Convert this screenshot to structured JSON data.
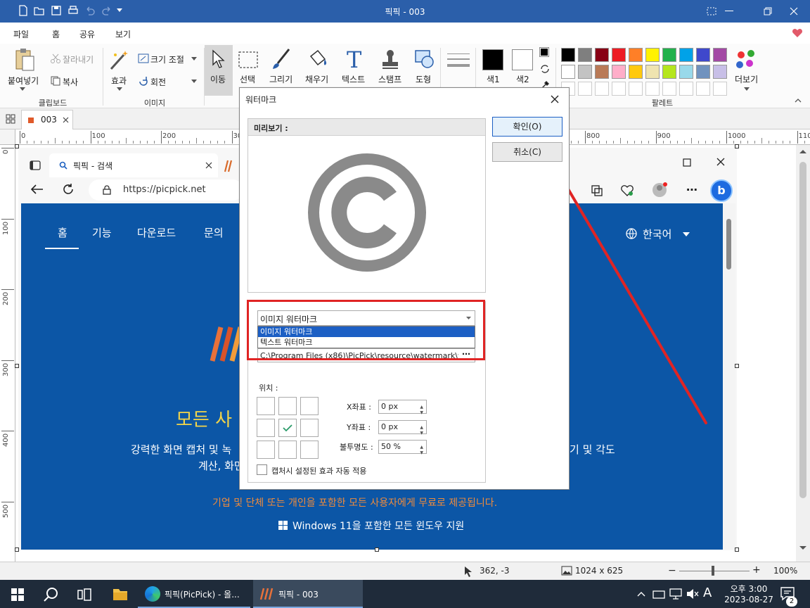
{
  "app": {
    "title": "픽픽 - 003"
  },
  "menu": [
    "파일",
    "홈",
    "공유",
    "보기"
  ],
  "ribbon": {
    "paste": "붙여넣기",
    "cut": "잘라내기",
    "copy": "복사",
    "clipboard_group": "클립보드",
    "effects": "효과",
    "resize": "크기 조절",
    "rotate": "회전",
    "image_group": "이미지",
    "tools": [
      "이동",
      "선택",
      "그리기",
      "채우기",
      "텍스트",
      "스탬프",
      "도형"
    ],
    "color1": "색1",
    "color2": "색2",
    "more": "더보기",
    "palette_group": "팔레트"
  },
  "palette": {
    "row1": [
      "#000000",
      "#7f7f7f",
      "#880015",
      "#ed1c24",
      "#ff7f27",
      "#fff200",
      "#22b14c",
      "#00a2e8",
      "#3f48cc",
      "#a349a4"
    ],
    "row2": [
      "#ffffff",
      "#c3c3c3",
      "#b97a57",
      "#ffaec9",
      "#ffc90e",
      "#efe4b0",
      "#b5e61d",
      "#99d9ea",
      "#7092be",
      "#c8bfe7"
    ]
  },
  "tab": {
    "name": "003"
  },
  "ruler": {
    "top": [
      "0",
      "100",
      "200",
      "300",
      "400",
      "500",
      "600",
      "700",
      "800",
      "900",
      "1000",
      "1100"
    ],
    "left": [
      "0",
      "100",
      "200",
      "300",
      "400",
      "500"
    ]
  },
  "browser": {
    "tab_title": "픽픽 - 검색",
    "url": "https://picpick.net",
    "nav": [
      "홈",
      "기능",
      "다운로드",
      "문의"
    ],
    "language": "한국어",
    "headline": "모든 사",
    "desc1_left": "강력한 화면 캡처 및 녹",
    "desc1_right": "기 및 각도",
    "desc2_left": "계산, 화면",
    "free_line": "기업 및 단체 또는 개인을 포함한 모든 사용자에게 무료로 제공됩니다.",
    "windows_line": "Windows 11을 포함한 모든 윈도우 지원",
    "colors": {
      "site_blue": "#0c56a6",
      "headline_yellow": "#f2d44a",
      "free_orange": "#f08b3b"
    }
  },
  "dialog": {
    "title": "워터마크",
    "ok": "확인(O)",
    "cancel": "취소(C)",
    "preview_label": "미리보기 :",
    "type_selected": "이미지 워터마크",
    "type_options": [
      "이미지 워터마크",
      "텍스트 워터마크"
    ],
    "path": "C:\\Program Files (x86)\\PicPick\\resource\\watermark\\w",
    "position_label": "위치 :",
    "x_label": "X좌표 :",
    "x_value": "0 px",
    "y_label": "Y좌표 :",
    "y_value": "0 px",
    "opacity_label": "불투명도 :",
    "opacity_value": "50 %",
    "auto_apply": "캡처시 설정된 효과 자동 적용",
    "highlight_color": "#e02424",
    "selected_color": "#1c5fc4"
  },
  "status": {
    "coords": "362, -3",
    "size": "1024 x 625",
    "zoom": "100%"
  },
  "taskbar": {
    "task1": "픽픽(PicPick) - 올...",
    "task2": "픽픽 - 003",
    "ampm": "오후 3:00",
    "date": "2023-08-27",
    "ime": "A",
    "notif_count": "2"
  }
}
